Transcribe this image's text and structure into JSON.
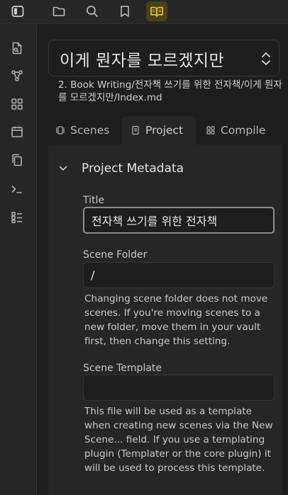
{
  "topbar": {
    "icons": [
      "sidebar-toggle-icon",
      "folder-icon",
      "search-icon",
      "bookmark-icon",
      "book-open-icon"
    ]
  },
  "ribbon": {
    "icons": [
      "open-file-icon",
      "graph-icon",
      "grid-icon",
      "calendar-icon",
      "copy-icon",
      "terminal-icon",
      "list-icon"
    ]
  },
  "project_select": {
    "value": "이게 뭔자를 모르겠지만"
  },
  "path": "2. Book Writing/전자책 쓰기를 위한 전자책/이게 뭔자를 모르겠지만/Index.md",
  "tabs": [
    {
      "label": "Scenes"
    },
    {
      "label": "Project"
    },
    {
      "label": "Compile"
    }
  ],
  "metadata": {
    "section_title": "Project Metadata",
    "title_label": "Title",
    "title_value": "전자책 쓰기를 위한 전자책",
    "scene_folder_label": "Scene Folder",
    "scene_folder_value": "/",
    "scene_folder_help": "Changing scene folder does not move scenes. If you're moving scenes to a new folder, move them in your vault first, then change this setting.",
    "scene_template_label": "Scene Template",
    "scene_template_value": "",
    "scene_template_help": "This file will be used as a template when creating new scenes via the New Scene... field. If you use a templating plugin (Templater or the core plugin) it will be used to process this template."
  },
  "colors": {
    "background": "#1e1e1e",
    "panel": "#262626",
    "active_ribbon_bg": "#4a4116",
    "active_ribbon_icon": "#e8c84a"
  }
}
